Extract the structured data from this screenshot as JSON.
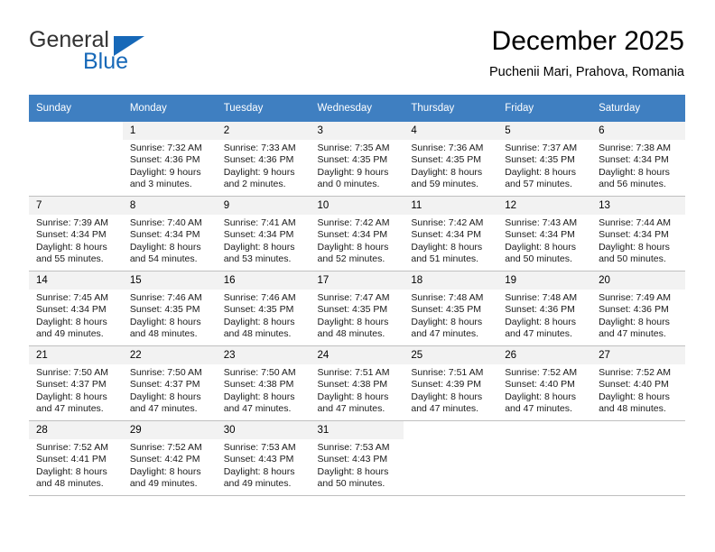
{
  "brand": {
    "name_top": "General",
    "name_bottom": "Blue",
    "accent_color": "#1668b8"
  },
  "header": {
    "title": "December 2025",
    "subtitle": "Puchenii Mari, Prahova, Romania"
  },
  "calendar": {
    "header_bg": "#3f7fc1",
    "daynum_bg": "#f2f2f2",
    "weekdays": [
      "Sunday",
      "Monday",
      "Tuesday",
      "Wednesday",
      "Thursday",
      "Friday",
      "Saturday"
    ],
    "weeks": [
      [
        {
          "day": "",
          "sunrise": "",
          "sunset": "",
          "daylight_1": "",
          "daylight_2": ""
        },
        {
          "day": "1",
          "sunrise": "Sunrise: 7:32 AM",
          "sunset": "Sunset: 4:36 PM",
          "daylight_1": "Daylight: 9 hours",
          "daylight_2": "and 3 minutes."
        },
        {
          "day": "2",
          "sunrise": "Sunrise: 7:33 AM",
          "sunset": "Sunset: 4:36 PM",
          "daylight_1": "Daylight: 9 hours",
          "daylight_2": "and 2 minutes."
        },
        {
          "day": "3",
          "sunrise": "Sunrise: 7:35 AM",
          "sunset": "Sunset: 4:35 PM",
          "daylight_1": "Daylight: 9 hours",
          "daylight_2": "and 0 minutes."
        },
        {
          "day": "4",
          "sunrise": "Sunrise: 7:36 AM",
          "sunset": "Sunset: 4:35 PM",
          "daylight_1": "Daylight: 8 hours",
          "daylight_2": "and 59 minutes."
        },
        {
          "day": "5",
          "sunrise": "Sunrise: 7:37 AM",
          "sunset": "Sunset: 4:35 PM",
          "daylight_1": "Daylight: 8 hours",
          "daylight_2": "and 57 minutes."
        },
        {
          "day": "6",
          "sunrise": "Sunrise: 7:38 AM",
          "sunset": "Sunset: 4:34 PM",
          "daylight_1": "Daylight: 8 hours",
          "daylight_2": "and 56 minutes."
        }
      ],
      [
        {
          "day": "7",
          "sunrise": "Sunrise: 7:39 AM",
          "sunset": "Sunset: 4:34 PM",
          "daylight_1": "Daylight: 8 hours",
          "daylight_2": "and 55 minutes."
        },
        {
          "day": "8",
          "sunrise": "Sunrise: 7:40 AM",
          "sunset": "Sunset: 4:34 PM",
          "daylight_1": "Daylight: 8 hours",
          "daylight_2": "and 54 minutes."
        },
        {
          "day": "9",
          "sunrise": "Sunrise: 7:41 AM",
          "sunset": "Sunset: 4:34 PM",
          "daylight_1": "Daylight: 8 hours",
          "daylight_2": "and 53 minutes."
        },
        {
          "day": "10",
          "sunrise": "Sunrise: 7:42 AM",
          "sunset": "Sunset: 4:34 PM",
          "daylight_1": "Daylight: 8 hours",
          "daylight_2": "and 52 minutes."
        },
        {
          "day": "11",
          "sunrise": "Sunrise: 7:42 AM",
          "sunset": "Sunset: 4:34 PM",
          "daylight_1": "Daylight: 8 hours",
          "daylight_2": "and 51 minutes."
        },
        {
          "day": "12",
          "sunrise": "Sunrise: 7:43 AM",
          "sunset": "Sunset: 4:34 PM",
          "daylight_1": "Daylight: 8 hours",
          "daylight_2": "and 50 minutes."
        },
        {
          "day": "13",
          "sunrise": "Sunrise: 7:44 AM",
          "sunset": "Sunset: 4:34 PM",
          "daylight_1": "Daylight: 8 hours",
          "daylight_2": "and 50 minutes."
        }
      ],
      [
        {
          "day": "14",
          "sunrise": "Sunrise: 7:45 AM",
          "sunset": "Sunset: 4:34 PM",
          "daylight_1": "Daylight: 8 hours",
          "daylight_2": "and 49 minutes."
        },
        {
          "day": "15",
          "sunrise": "Sunrise: 7:46 AM",
          "sunset": "Sunset: 4:35 PM",
          "daylight_1": "Daylight: 8 hours",
          "daylight_2": "and 48 minutes."
        },
        {
          "day": "16",
          "sunrise": "Sunrise: 7:46 AM",
          "sunset": "Sunset: 4:35 PM",
          "daylight_1": "Daylight: 8 hours",
          "daylight_2": "and 48 minutes."
        },
        {
          "day": "17",
          "sunrise": "Sunrise: 7:47 AM",
          "sunset": "Sunset: 4:35 PM",
          "daylight_1": "Daylight: 8 hours",
          "daylight_2": "and 48 minutes."
        },
        {
          "day": "18",
          "sunrise": "Sunrise: 7:48 AM",
          "sunset": "Sunset: 4:35 PM",
          "daylight_1": "Daylight: 8 hours",
          "daylight_2": "and 47 minutes."
        },
        {
          "day": "19",
          "sunrise": "Sunrise: 7:48 AM",
          "sunset": "Sunset: 4:36 PM",
          "daylight_1": "Daylight: 8 hours",
          "daylight_2": "and 47 minutes."
        },
        {
          "day": "20",
          "sunrise": "Sunrise: 7:49 AM",
          "sunset": "Sunset: 4:36 PM",
          "daylight_1": "Daylight: 8 hours",
          "daylight_2": "and 47 minutes."
        }
      ],
      [
        {
          "day": "21",
          "sunrise": "Sunrise: 7:50 AM",
          "sunset": "Sunset: 4:37 PM",
          "daylight_1": "Daylight: 8 hours",
          "daylight_2": "and 47 minutes."
        },
        {
          "day": "22",
          "sunrise": "Sunrise: 7:50 AM",
          "sunset": "Sunset: 4:37 PM",
          "daylight_1": "Daylight: 8 hours",
          "daylight_2": "and 47 minutes."
        },
        {
          "day": "23",
          "sunrise": "Sunrise: 7:50 AM",
          "sunset": "Sunset: 4:38 PM",
          "daylight_1": "Daylight: 8 hours",
          "daylight_2": "and 47 minutes."
        },
        {
          "day": "24",
          "sunrise": "Sunrise: 7:51 AM",
          "sunset": "Sunset: 4:38 PM",
          "daylight_1": "Daylight: 8 hours",
          "daylight_2": "and 47 minutes."
        },
        {
          "day": "25",
          "sunrise": "Sunrise: 7:51 AM",
          "sunset": "Sunset: 4:39 PM",
          "daylight_1": "Daylight: 8 hours",
          "daylight_2": "and 47 minutes."
        },
        {
          "day": "26",
          "sunrise": "Sunrise: 7:52 AM",
          "sunset": "Sunset: 4:40 PM",
          "daylight_1": "Daylight: 8 hours",
          "daylight_2": "and 47 minutes."
        },
        {
          "day": "27",
          "sunrise": "Sunrise: 7:52 AM",
          "sunset": "Sunset: 4:40 PM",
          "daylight_1": "Daylight: 8 hours",
          "daylight_2": "and 48 minutes."
        }
      ],
      [
        {
          "day": "28",
          "sunrise": "Sunrise: 7:52 AM",
          "sunset": "Sunset: 4:41 PM",
          "daylight_1": "Daylight: 8 hours",
          "daylight_2": "and 48 minutes."
        },
        {
          "day": "29",
          "sunrise": "Sunrise: 7:52 AM",
          "sunset": "Sunset: 4:42 PM",
          "daylight_1": "Daylight: 8 hours",
          "daylight_2": "and 49 minutes."
        },
        {
          "day": "30",
          "sunrise": "Sunrise: 7:53 AM",
          "sunset": "Sunset: 4:43 PM",
          "daylight_1": "Daylight: 8 hours",
          "daylight_2": "and 49 minutes."
        },
        {
          "day": "31",
          "sunrise": "Sunrise: 7:53 AM",
          "sunset": "Sunset: 4:43 PM",
          "daylight_1": "Daylight: 8 hours",
          "daylight_2": "and 50 minutes."
        },
        {
          "day": "",
          "sunrise": "",
          "sunset": "",
          "daylight_1": "",
          "daylight_2": ""
        },
        {
          "day": "",
          "sunrise": "",
          "sunset": "",
          "daylight_1": "",
          "daylight_2": ""
        },
        {
          "day": "",
          "sunrise": "",
          "sunset": "",
          "daylight_1": "",
          "daylight_2": ""
        }
      ]
    ]
  }
}
